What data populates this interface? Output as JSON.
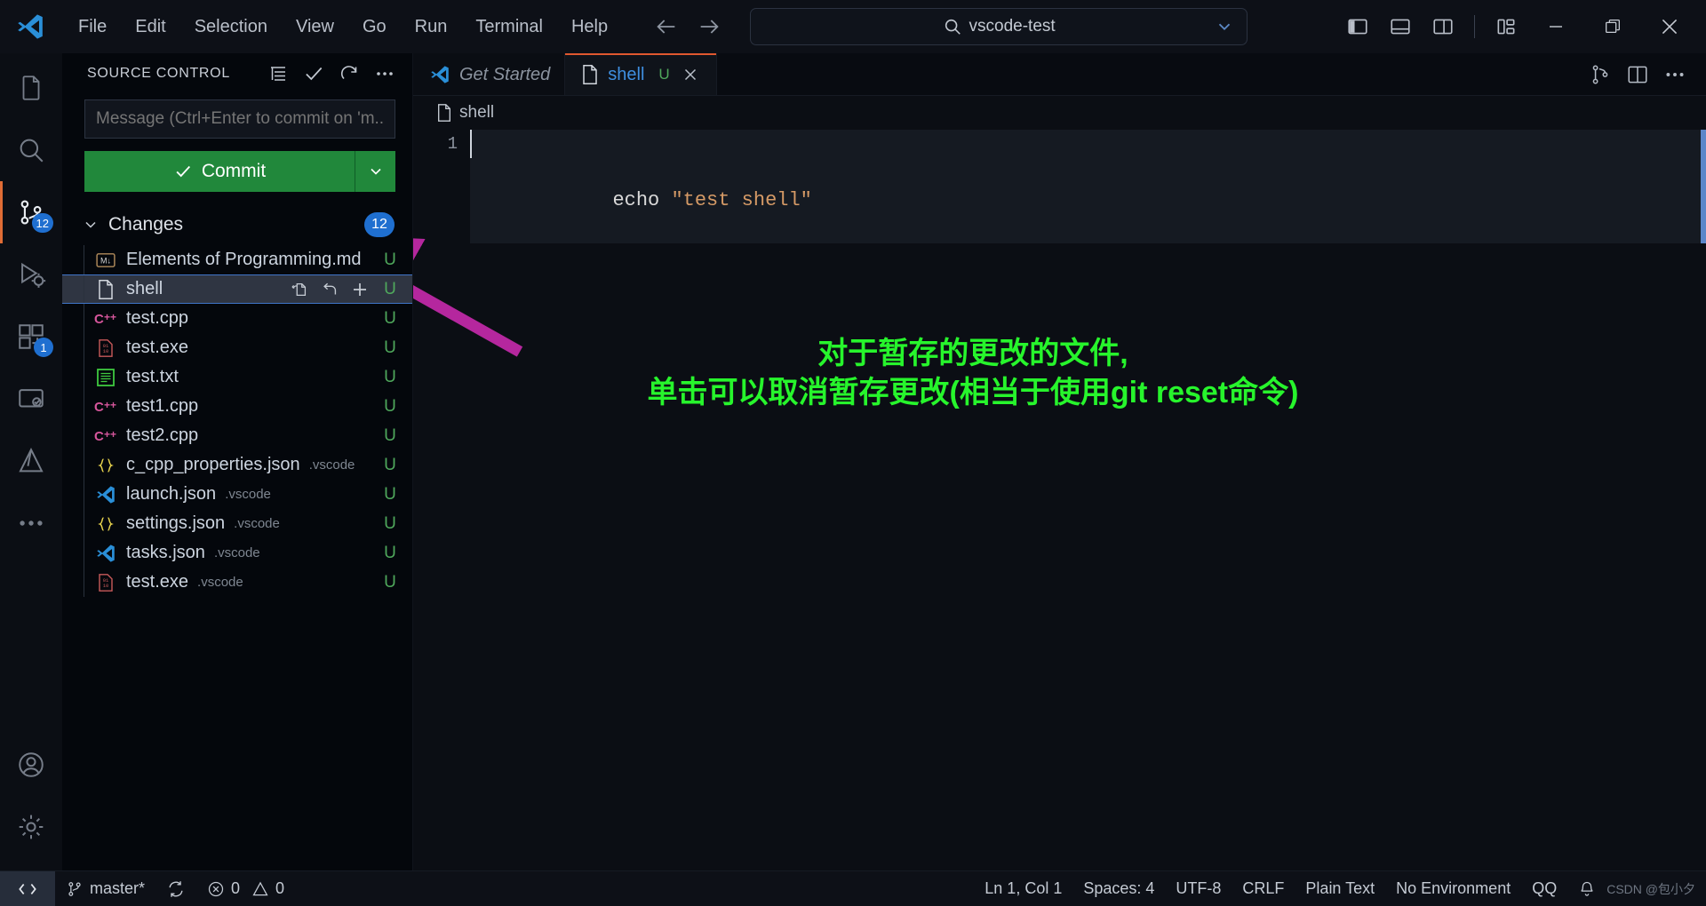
{
  "window": {
    "title": "vscode-test",
    "search_placeholder": "",
    "search_value": "vscode-test"
  },
  "titlebar": {
    "logo_icon": "vscode-logo-icon",
    "menus": [
      "File",
      "Edit",
      "Selection",
      "View",
      "Go",
      "Run",
      "Terminal",
      "Help"
    ],
    "nav": {
      "back_icon": "arrow-left-icon",
      "forward_icon": "arrow-right-icon"
    },
    "search_icon": "search-icon",
    "dropdown_icon": "chevron-down-icon",
    "layout_icons": [
      "toggle-primary-sidebar-icon",
      "toggle-panel-icon",
      "toggle-secondary-sidebar-icon",
      "customize-layout-icon"
    ],
    "window_controls": [
      "minimize-icon",
      "restore-icon",
      "close-icon"
    ]
  },
  "activitybar": {
    "items": [
      {
        "name": "explorer",
        "icon": "files-icon",
        "active": false,
        "badge": ""
      },
      {
        "name": "search",
        "icon": "search-icon",
        "active": false,
        "badge": ""
      },
      {
        "name": "source-control",
        "icon": "source-control-icon",
        "active": true,
        "badge": "12"
      },
      {
        "name": "run-and-debug",
        "icon": "debug-icon",
        "active": false,
        "badge": ""
      },
      {
        "name": "extensions",
        "icon": "extensions-icon",
        "active": false,
        "badge": "1"
      },
      {
        "name": "remote-explorer",
        "icon": "remote-explorer-icon",
        "active": false,
        "badge": ""
      },
      {
        "name": "cmake",
        "icon": "cmake-icon",
        "active": false,
        "badge": ""
      },
      {
        "name": "more-views",
        "icon": "ellipsis-icon",
        "active": false,
        "badge": ""
      }
    ],
    "bottom_items": [
      {
        "name": "accounts",
        "icon": "account-icon"
      },
      {
        "name": "manage",
        "icon": "gear-icon"
      }
    ]
  },
  "sidebar": {
    "title": "SOURCE CONTROL",
    "actions": [
      {
        "name": "view-as-tree",
        "icon": "list-tree-icon"
      },
      {
        "name": "commit",
        "icon": "check-icon"
      },
      {
        "name": "refresh",
        "icon": "refresh-icon"
      },
      {
        "name": "views-and-more-actions",
        "icon": "ellipsis-icon"
      }
    ],
    "commit_message_placeholder": "Message (Ctrl+Enter to commit on 'm...",
    "commit_message_value": "",
    "commit_button_label": "Commit",
    "commit_button_icon": "check-icon",
    "commit_dropdown_icon": "chevron-down-icon",
    "changes": {
      "label": "Changes",
      "count": "12",
      "expanded_icon": "chevron-down-icon"
    },
    "files": [
      {
        "name": "Elements of Programming.md",
        "dir": "",
        "icon": "markdown-icon",
        "status": "U",
        "selected": false
      },
      {
        "name": "shell",
        "dir": "",
        "icon": "file-icon",
        "status": "U",
        "selected": true,
        "actions": [
          {
            "name": "open-file",
            "icon": "open-file-icon"
          },
          {
            "name": "discard-changes",
            "icon": "discard-icon"
          },
          {
            "name": "stage-changes",
            "icon": "plus-icon"
          }
        ]
      },
      {
        "name": "test.cpp",
        "dir": "",
        "icon": "cpp-icon",
        "status": "U",
        "selected": false
      },
      {
        "name": "test.exe",
        "dir": "",
        "icon": "binary-icon",
        "status": "U",
        "selected": false
      },
      {
        "name": "test.txt",
        "dir": "",
        "icon": "text-icon",
        "status": "U",
        "selected": false
      },
      {
        "name": "test1.cpp",
        "dir": "",
        "icon": "cpp-icon",
        "status": "U",
        "selected": false
      },
      {
        "name": "test2.cpp",
        "dir": "",
        "icon": "cpp-icon",
        "status": "U",
        "selected": false
      },
      {
        "name": "c_cpp_properties.json",
        "dir": ".vscode",
        "icon": "json-icon",
        "status": "U",
        "selected": false
      },
      {
        "name": "launch.json",
        "dir": ".vscode",
        "icon": "vscode-json-icon",
        "status": "U",
        "selected": false
      },
      {
        "name": "settings.json",
        "dir": ".vscode",
        "icon": "json-icon",
        "status": "U",
        "selected": false
      },
      {
        "name": "tasks.json",
        "dir": ".vscode",
        "icon": "vscode-json-icon",
        "status": "U",
        "selected": false
      },
      {
        "name": "test.exe",
        "dir": ".vscode",
        "icon": "binary-icon",
        "status": "U",
        "selected": false
      }
    ]
  },
  "editor": {
    "tabs": [
      {
        "label": "Get Started",
        "icon": "vscode-logo-icon",
        "active": false,
        "italic": true,
        "dirty": "",
        "closable": false
      },
      {
        "label": "shell",
        "icon": "file-icon",
        "active": true,
        "italic": false,
        "dirty": "U",
        "closable": true
      }
    ],
    "tab_actions": [
      {
        "name": "split-editor-horizontal",
        "icon": "split-horizontal-icon"
      },
      {
        "name": "split-editor",
        "icon": "split-editor-icon"
      },
      {
        "name": "more-actions",
        "icon": "ellipsis-icon"
      }
    ],
    "breadcrumb": {
      "icon": "file-icon",
      "label": "shell"
    },
    "lines": [
      {
        "number": "1",
        "tokens": [
          {
            "text": "echo ",
            "type": "cmd"
          },
          {
            "text": "\"test shell\"",
            "type": "str"
          }
        ]
      }
    ]
  },
  "annotation": {
    "line1": "对于暂存的更改的文件,",
    "line2": "单击可以取消暂存更改(相当于使用git reset命令)",
    "color": "#27f52c",
    "arrow_color": "#b5279e"
  },
  "statusbar": {
    "remote_icon": "remote-indicator-icon",
    "left_items": [
      {
        "name": "branch",
        "icon": "git-branch-icon",
        "label": "master*"
      },
      {
        "name": "sync-changes",
        "icon": "sync-icon",
        "label": ""
      },
      {
        "name": "problems",
        "icon": "error-warning-icon",
        "label": "0  0",
        "errors": "0",
        "warnings": "0"
      }
    ],
    "right_items": [
      {
        "name": "editor-position",
        "label": "Ln 1, Col 1"
      },
      {
        "name": "indentation",
        "label": "Spaces: 4"
      },
      {
        "name": "encoding",
        "label": "UTF-8"
      },
      {
        "name": "eol",
        "label": "CRLF"
      },
      {
        "name": "language-mode",
        "label": "Plain Text"
      },
      {
        "name": "cmake-environment",
        "label": "No Environment"
      },
      {
        "name": "qq-extension",
        "label": "QQ"
      },
      {
        "name": "notifications",
        "label": ""
      }
    ],
    "watermark": "CSDN @包小夕"
  }
}
